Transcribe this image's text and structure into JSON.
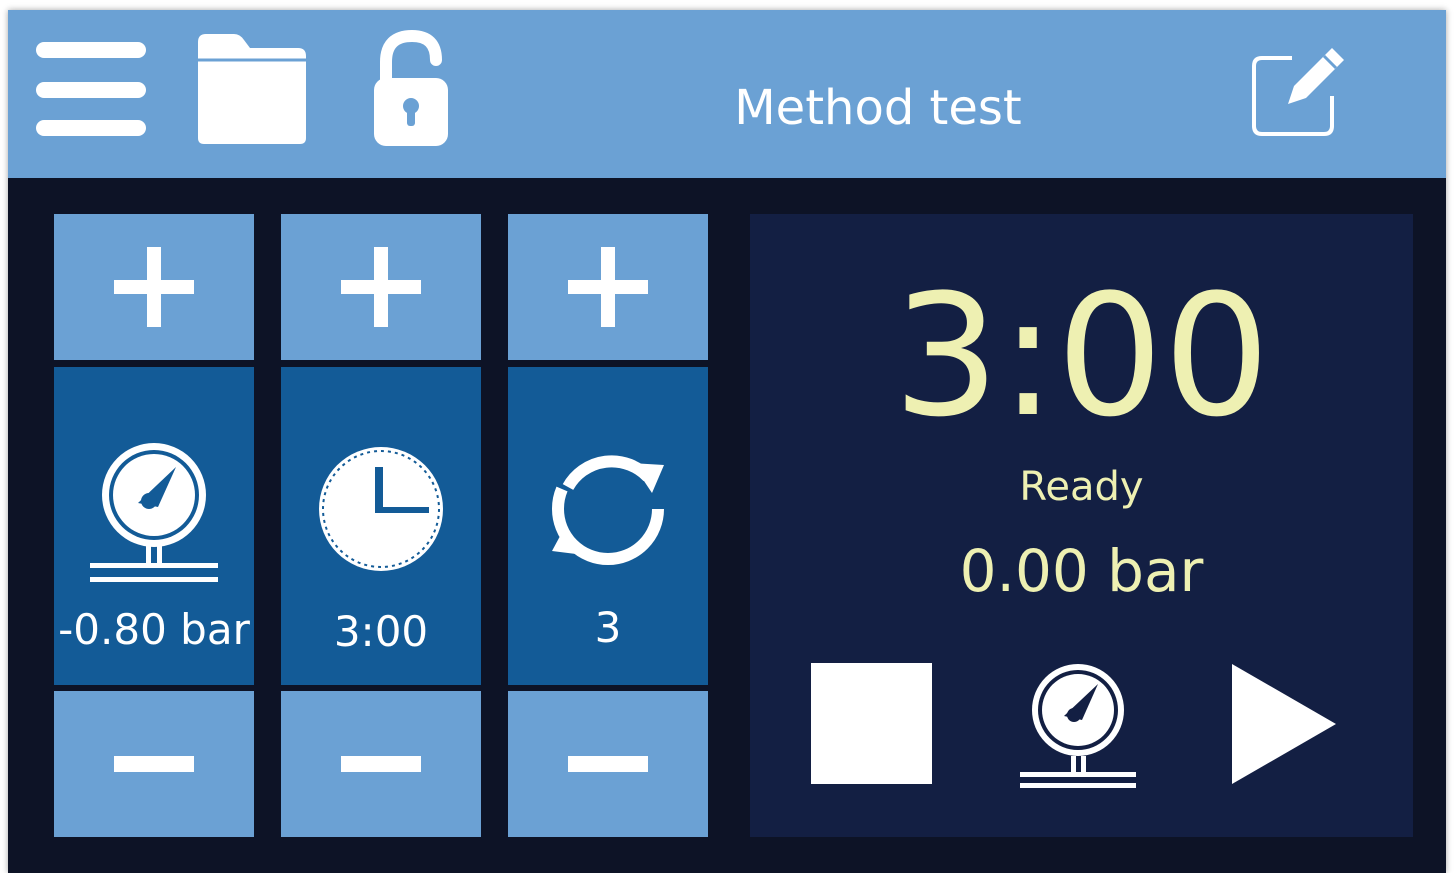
{
  "header": {
    "title": "Method test",
    "icons": [
      "hamburger-menu-icon",
      "folder-icon",
      "unlock-icon",
      "edit-icon"
    ]
  },
  "parameters": [
    {
      "name": "pressure",
      "value": "-0.80 bar",
      "icon": "pressure-gauge-icon"
    },
    {
      "name": "time",
      "value": "3:00",
      "icon": "clock-icon"
    },
    {
      "name": "cycles",
      "value": "3",
      "icon": "repeat-icon"
    }
  ],
  "status": {
    "timer": "3:00",
    "state": "Ready",
    "pressure": "0.00 bar"
  },
  "controls": {
    "icons": [
      "stop-icon",
      "pressure-gauge-icon",
      "play-icon"
    ]
  },
  "colors": {
    "header_bg": "#6ba1d4",
    "tile_bg": "#6ba1d4",
    "param_bg": "#135b97",
    "panel_bg": "#131f43",
    "screen_bg": "#0d1326",
    "accent_text": "#eef0b2"
  }
}
